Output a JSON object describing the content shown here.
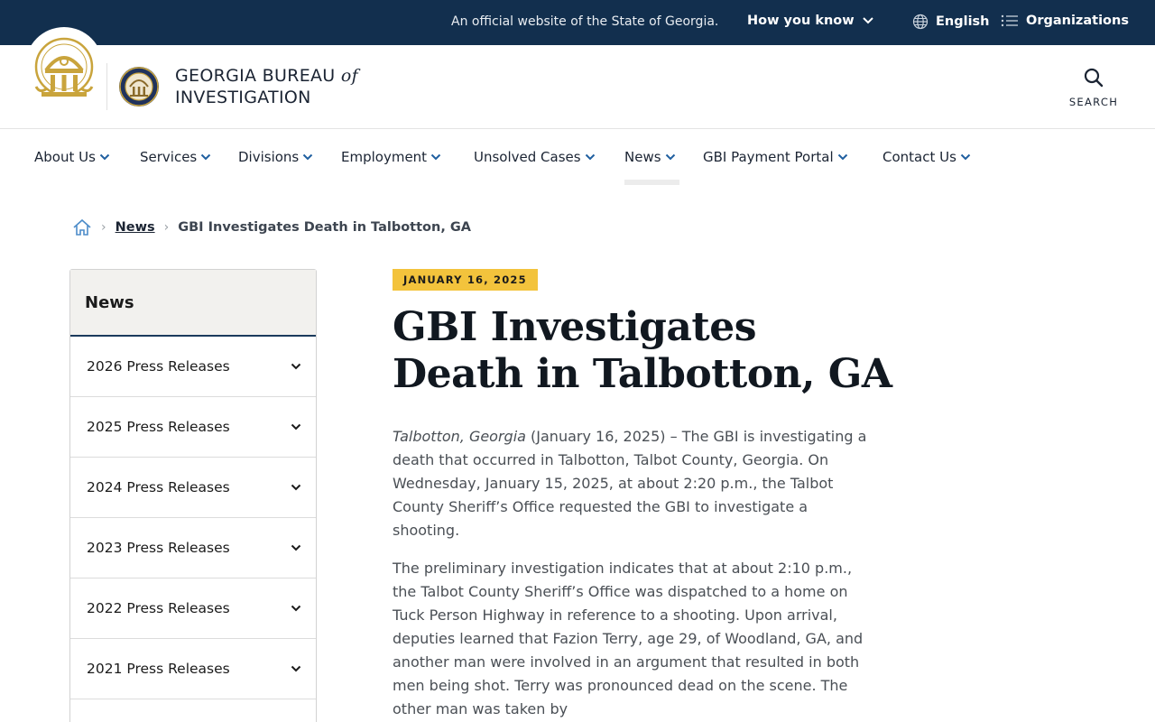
{
  "topbar": {
    "official_text": "An official website of the State of Georgia.",
    "how_you_know": "How you know",
    "language": "English",
    "organizations": "Organizations"
  },
  "header": {
    "brand_line1": "GEORGIA BUREAU",
    "brand_of": "of",
    "brand_line2": "INVESTIGATION",
    "search_label": "SEARCH"
  },
  "nav": {
    "items": [
      {
        "label": "About Us"
      },
      {
        "label": "Services"
      },
      {
        "label": "Divisions"
      },
      {
        "label": "Employment"
      },
      {
        "label": "Unsolved Cases"
      },
      {
        "label": "News",
        "active": true
      },
      {
        "label": "GBI Payment Portal"
      },
      {
        "label": "Contact Us"
      }
    ]
  },
  "breadcrumb": {
    "news": "News",
    "current": "GBI Investigates Death in Talbotton, GA"
  },
  "sidebar": {
    "title": "News",
    "items": [
      {
        "label": "2026 Press Releases"
      },
      {
        "label": "2025 Press Releases"
      },
      {
        "label": "2024 Press Releases"
      },
      {
        "label": "2023 Press Releases"
      },
      {
        "label": "2022 Press Releases"
      },
      {
        "label": "2021 Press Releases"
      }
    ]
  },
  "article": {
    "date": "JANUARY 16, 2025",
    "title": "GBI Investigates Death in Talbotton, GA",
    "p1_place": "Talbotton, Georgia",
    "p1_text": " (January 16, 2025) – The GBI is investigating a death that occurred in Talbotton, Talbot County, Georgia. On Wednesday, January 15, 2025, at about 2:20 p.m., the Talbot County Sheriff’s Office requested the GBI to investigate a shooting.",
    "p2_text": "The preliminary investigation indicates that at about 2:10 p.m., the Talbot County Sheriff’s Office was dispatched to a home on Tuck Person Highway in reference to a shooting. Upon arrival, deputies learned that Fazion Terry, age 29, of Woodland, GA, and another man were involved in an argument that resulted in both men being shot. Terry was pronounced dead on the scene. The other man was taken by"
  },
  "colors": {
    "topbar": "#122f4e",
    "accent_gold": "#f3c33c",
    "link_blue": "#1f5fa0"
  }
}
